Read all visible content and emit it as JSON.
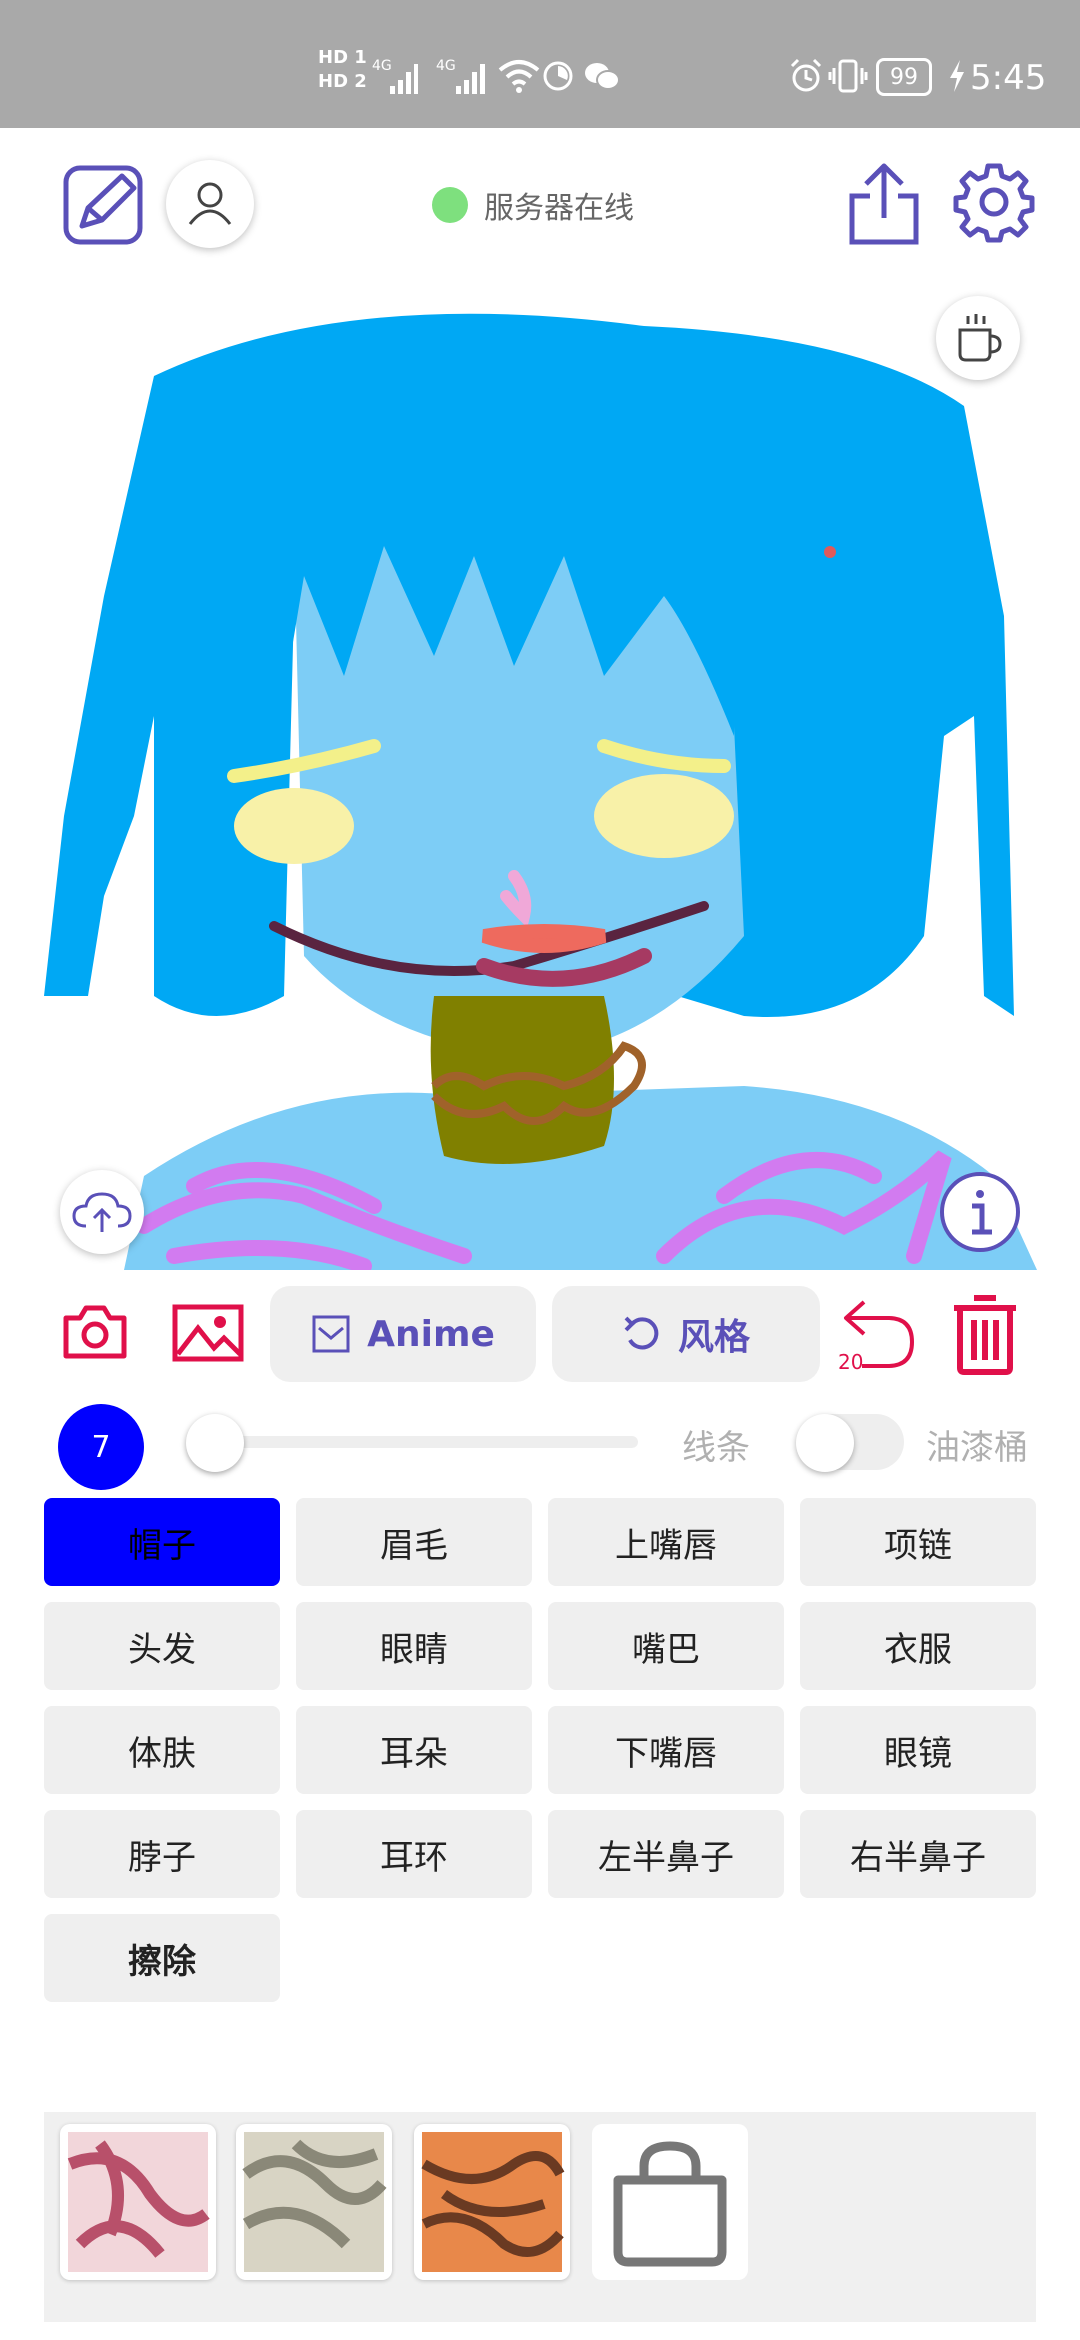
{
  "status_bar": {
    "hd1": "HD 1",
    "hd2": "HD 2",
    "net1": "4G",
    "net2": "4G",
    "battery": "99",
    "time": "5:45"
  },
  "toolbar": {
    "server_status": "服务器在线",
    "icons": [
      "edit-icon",
      "user-icon",
      "share-icon",
      "settings-icon",
      "coffee-icon"
    ]
  },
  "canvas": {
    "colors": {
      "hair": "#00a8f4",
      "skin": "#7dcdf6",
      "eyebrows": "#f3f08a",
      "eyes": "#f8f1a8",
      "nose": "#f0a8d8",
      "upper_lip": "#ee6a5e",
      "lower_lip": "#a63a62",
      "mouth": "#5a2440",
      "neck": "#808000",
      "necklace": "#a0622a",
      "clothes": "#d27bf0"
    }
  },
  "tools": {
    "style_button": "Anime",
    "reset_button": "风格",
    "undo_count": "20"
  },
  "brush": {
    "size": "7",
    "color": "#0000ff",
    "line_label": "线条",
    "bucket_label": "油漆桶",
    "slider_value": 0
  },
  "parts": [
    {
      "label": "帽子",
      "active": true
    },
    {
      "label": "眉毛",
      "active": false
    },
    {
      "label": "上嘴唇",
      "active": false
    },
    {
      "label": "项链",
      "active": false
    },
    {
      "label": "头发",
      "active": false
    },
    {
      "label": "眼睛",
      "active": false
    },
    {
      "label": "嘴巴",
      "active": false
    },
    {
      "label": "衣服",
      "active": false
    },
    {
      "label": "体肤",
      "active": false
    },
    {
      "label": "耳朵",
      "active": false
    },
    {
      "label": "下嘴唇",
      "active": false
    },
    {
      "label": "眼镜",
      "active": false
    },
    {
      "label": "脖子",
      "active": false
    },
    {
      "label": "耳环",
      "active": false
    },
    {
      "label": "左半鼻子",
      "active": false
    },
    {
      "label": "右半鼻子",
      "active": false
    },
    {
      "label": "擦除",
      "active": false
    }
  ],
  "textures": {
    "colors": [
      "#b8506a",
      "#8a8878",
      "#e8884a"
    ],
    "shop_icon": "shopping-bag-icon"
  }
}
